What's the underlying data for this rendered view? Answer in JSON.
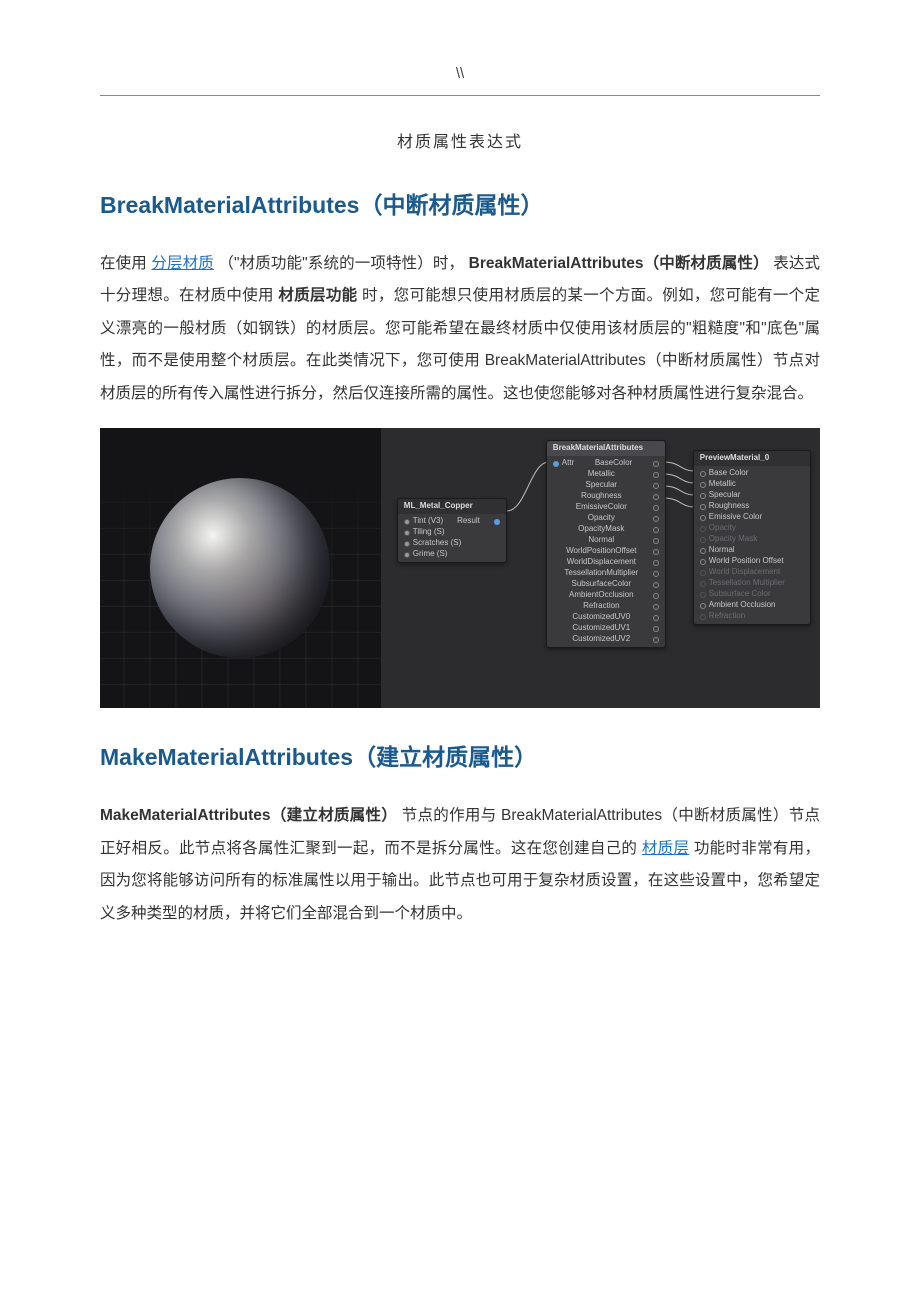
{
  "header": {
    "mark": "\\\\"
  },
  "doc": {
    "title": "材质属性表达式"
  },
  "section1": {
    "heading_en": "BreakMaterialAttributes",
    "heading_cn": "（中断材质属性）",
    "p1_a": "在使用 ",
    "p1_link": "分层材质",
    "p1_b": " （\"材质功能\"系统的一项特性）时，",
    "p1_strong": "BreakMaterialAttributes（中断材质属性）",
    "p1_c": "表达式十分理想。在材质中使用 ",
    "p1_strong2": "材质层功能",
    "p1_d": " 时，您可能想只使用材质层的某一个方面。例如，您可能有一个定义漂亮的一般材质（如钢铁）的材质层。您可能希望在最终材质中仅使用该材质层的\"粗糙度\"和\"底色\"属性，而不是使用整个材质层。在此类情况下，您可使用 BreakMaterialAttributes（中断材质属性）节点对材质层的所有传入属性进行拆分，然后仅连接所需的属性。这也使您能够对各种材质属性进行复杂混合。"
  },
  "editor": {
    "node_ml": {
      "title": "ML_Metal_Copper",
      "rows": [
        {
          "label": "Tint (V3)",
          "out": "Result"
        },
        {
          "label": "Tiling (S)"
        },
        {
          "label": "Scratches (S)"
        },
        {
          "label": "Grime (S)"
        }
      ]
    },
    "node_break": {
      "title": "BreakMaterialAttributes",
      "in_label": "Attr",
      "outputs": [
        "BaseColor",
        "Metallic",
        "Specular",
        "Roughness",
        "EmissiveColor",
        "Opacity",
        "OpacityMask",
        "Normal",
        "WorldPositionOffset",
        "WorldDisplacement",
        "TessellationMultiplier",
        "SubsurfaceColor",
        "AmbientOcclusion",
        "Refraction",
        "CustomizedUV0",
        "CustomizedUV1",
        "CustomizedUV2"
      ]
    },
    "node_preview": {
      "title": "PreviewMaterial_0",
      "inputs": [
        {
          "label": "Base Color",
          "active": true
        },
        {
          "label": "Metallic",
          "active": true
        },
        {
          "label": "Specular",
          "active": true
        },
        {
          "label": "Roughness",
          "active": true
        },
        {
          "label": "Emissive Color",
          "active": true
        },
        {
          "label": "Opacity",
          "active": false
        },
        {
          "label": "Opacity Mask",
          "active": false
        },
        {
          "label": "Normal",
          "active": true
        },
        {
          "label": "World Position Offset",
          "active": true
        },
        {
          "label": "World Displacement",
          "active": false
        },
        {
          "label": "Tessellation Multiplier",
          "active": false
        },
        {
          "label": "Subsurface Color",
          "active": false
        },
        {
          "label": "Ambient Occlusion",
          "active": true
        },
        {
          "label": "Refraction",
          "active": false
        }
      ]
    }
  },
  "section2": {
    "heading_en": "MakeMaterialAttributes",
    "heading_cn": "（建立材质属性）",
    "p1_a": "MakeMaterialAttributes（建立材质属性）",
    "p1_b": "节点的作用与 BreakMaterialAttributes（中断材质属性）节点正好相反。此节点将各属性汇聚到一起，而不是拆分属性。这在您创建自己的 ",
    "p1_link": "材质层",
    "p1_c": " 功能时非常有用，因为您将能够访问所有的标准属性以用于输出。此节点也可用于复杂材质设置，在这些设置中，您希望定义多种类型的材质，并将它们全部混合到一个材质中。"
  }
}
